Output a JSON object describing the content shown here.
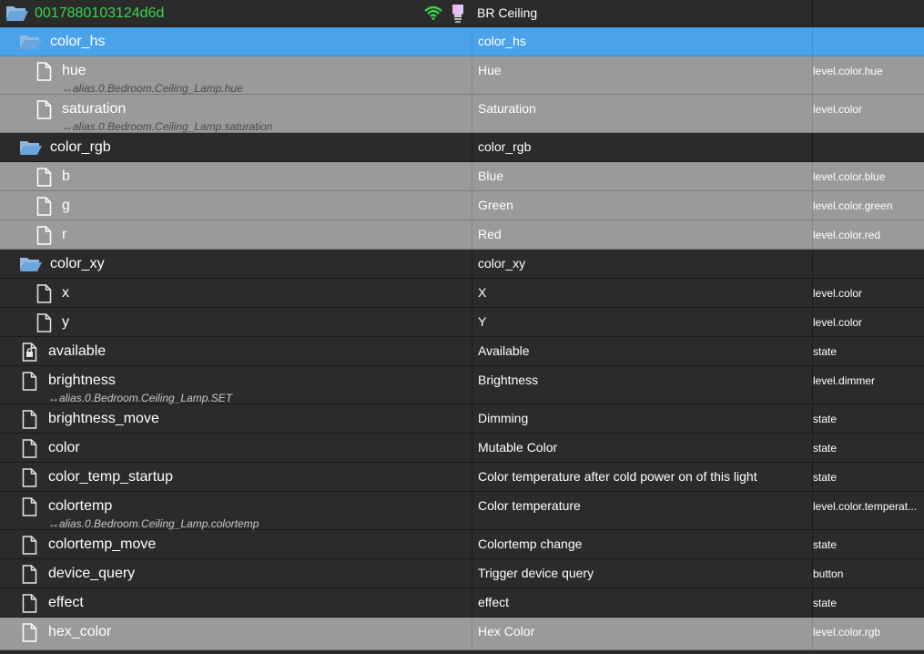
{
  "header": {
    "device_id": "0017880103124d6d",
    "device_name": "BR Ceiling",
    "wifi_icon": "wifi-icon",
    "bulb_icon": "lightbulb-icon"
  },
  "rows": [
    {
      "name": "color_hs",
      "role": "color_hs",
      "type": "",
      "alias": "",
      "icon": "folder-open-icon",
      "style": "selected"
    },
    {
      "name": "hue",
      "role": "Hue",
      "type": "level.color.hue",
      "alias": "↔alias.0.Bedroom.Ceiling_Lamp.hue",
      "icon": "file-icon",
      "style": "gray"
    },
    {
      "name": "saturation",
      "role": "Saturation",
      "type": "level.color",
      "alias": "↔alias.0.Bedroom.Ceiling_Lamp.saturation",
      "icon": "file-icon",
      "style": "gray"
    },
    {
      "name": "color_rgb",
      "role": "color_rgb",
      "type": "",
      "alias": "",
      "icon": "folder-open-icon",
      "style": "dark"
    },
    {
      "name": "b",
      "role": "Blue",
      "type": "level.color.blue",
      "alias": "",
      "icon": "file-icon",
      "style": "gray"
    },
    {
      "name": "g",
      "role": "Green",
      "type": "level.color.green",
      "alias": "",
      "icon": "file-icon",
      "style": "gray"
    },
    {
      "name": "r",
      "role": "Red",
      "type": "level.color.red",
      "alias": "",
      "icon": "file-icon",
      "style": "gray"
    },
    {
      "name": "color_xy",
      "role": "color_xy",
      "type": "",
      "alias": "",
      "icon": "folder-open-icon",
      "style": "dark"
    },
    {
      "name": "x",
      "role": "X",
      "type": "level.color",
      "alias": "",
      "icon": "file-icon",
      "style": "dark"
    },
    {
      "name": "y",
      "role": "Y",
      "type": "level.color",
      "alias": "",
      "icon": "file-icon",
      "style": "dark"
    },
    {
      "name": "available",
      "role": "Available",
      "type": "state",
      "alias": "",
      "icon": "file-lock-icon",
      "style": "dark"
    },
    {
      "name": "brightness",
      "role": "Brightness",
      "type": "level.dimmer",
      "alias": "↔alias.0.Bedroom.Ceiling_Lamp.SET",
      "icon": "file-icon",
      "style": "dark"
    },
    {
      "name": "brightness_move",
      "role": "Dimming",
      "type": "state",
      "alias": "",
      "icon": "file-icon",
      "style": "dark"
    },
    {
      "name": "color",
      "role": "Mutable Color",
      "type": "state",
      "alias": "",
      "icon": "file-icon",
      "style": "dark"
    },
    {
      "name": "color_temp_startup",
      "role": "Color temperature after cold power on of this light",
      "type": "state",
      "alias": "",
      "icon": "file-icon",
      "style": "dark"
    },
    {
      "name": "colortemp",
      "role": "Color temperature",
      "type": "level.color.temperat...",
      "alias": "↔alias.0.Bedroom.Ceiling_Lamp.colortemp",
      "icon": "file-icon",
      "style": "dark"
    },
    {
      "name": "colortemp_move",
      "role": "Colortemp change",
      "type": "state",
      "alias": "",
      "icon": "file-icon",
      "style": "dark"
    },
    {
      "name": "device_query",
      "role": "Trigger device query",
      "type": "button",
      "alias": "",
      "icon": "file-icon",
      "style": "dark"
    },
    {
      "name": "effect",
      "role": "effect",
      "type": "state",
      "alias": "",
      "icon": "file-icon",
      "style": "dark"
    },
    {
      "name": "hex_color",
      "role": "Hex Color",
      "type": "level.color.rgb",
      "alias": "",
      "icon": "file-icon",
      "style": "gray"
    }
  ],
  "colors": {
    "selected": "#4aa3ea",
    "gray_row": "#9a9a9a",
    "dark_row": "#2b2b2b",
    "device_id": "#39d44d",
    "folder": "#6aa6dc"
  }
}
